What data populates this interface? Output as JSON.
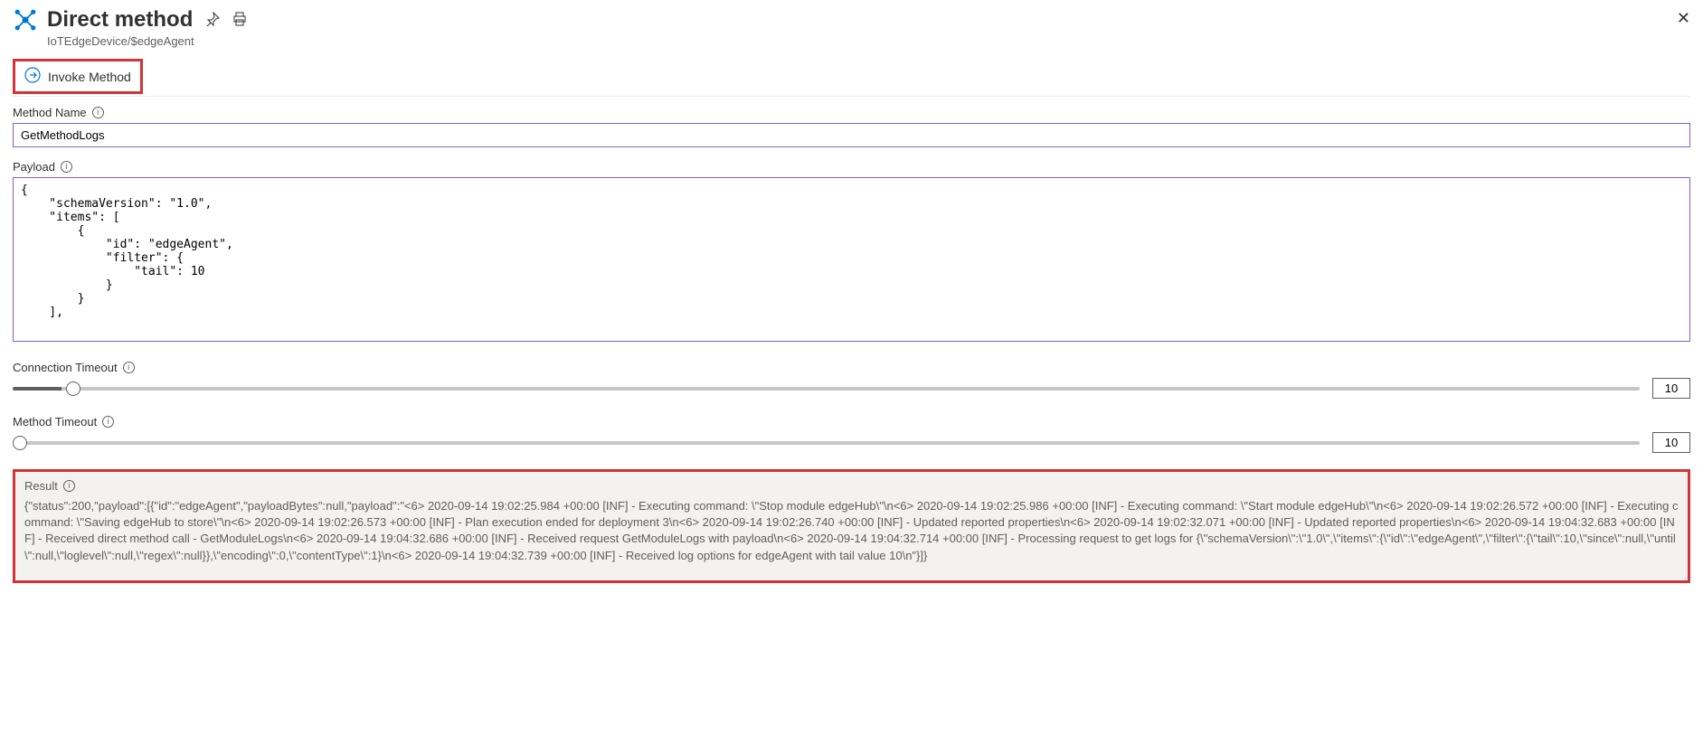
{
  "header": {
    "title": "Direct method",
    "breadcrumb": "IoTEdgeDevice/$edgeAgent"
  },
  "toolbar": {
    "invoke_label": "Invoke Method"
  },
  "fields": {
    "method_name_label": "Method Name",
    "method_name_value": "GetMethodLogs",
    "payload_label": "Payload",
    "payload_value": "{\n    \"schemaVersion\": \"1.0\",\n    \"items\": [\n        {\n            \"id\": \"edgeAgent\",\n            \"filter\": {\n                \"tail\": 10\n            }\n        }\n    ],",
    "connection_timeout_label": "Connection Timeout",
    "connection_timeout_value": "10",
    "method_timeout_label": "Method Timeout",
    "method_timeout_value": "10"
  },
  "result": {
    "label": "Result",
    "content": "{\"status\":200,\"payload\":[{\"id\":\"edgeAgent\",\"payloadBytes\":null,\"payload\":\"<6> 2020-09-14 19:02:25.984 +00:00 [INF] - Executing command: \\\"Stop module edgeHub\\\"\\n<6> 2020-09-14 19:02:25.986 +00:00 [INF] - Executing command: \\\"Start module edgeHub\\\"\\n<6> 2020-09-14 19:02:26.572 +00:00 [INF] - Executing command: \\\"Saving edgeHub to store\\\"\\n<6> 2020-09-14 19:02:26.573 +00:00 [INF] - Plan execution ended for deployment 3\\n<6> 2020-09-14 19:02:26.740 +00:00 [INF] - Updated reported properties\\n<6> 2020-09-14 19:02:32.071 +00:00 [INF] - Updated reported properties\\n<6> 2020-09-14 19:04:32.683 +00:00 [INF] - Received direct method call - GetModuleLogs\\n<6> 2020-09-14 19:04:32.686 +00:00 [INF] - Received request GetModuleLogs with payload\\n<6> 2020-09-14 19:04:32.714 +00:00 [INF] - Processing request to get logs for {\\\"schemaVersion\\\":\\\"1.0\\\",\\\"items\\\":{\\\"id\\\":\\\"edgeAgent\\\",\\\"filter\\\":{\\\"tail\\\":10,\\\"since\\\":null,\\\"until\\\":null,\\\"loglevel\\\":null,\\\"regex\\\":null}},\\\"encoding\\\":0,\\\"contentType\\\":1}\\n<6> 2020-09-14 19:04:32.739 +00:00 [INF] - Received log options for edgeAgent with tail value 10\\n\"}]}"
  }
}
